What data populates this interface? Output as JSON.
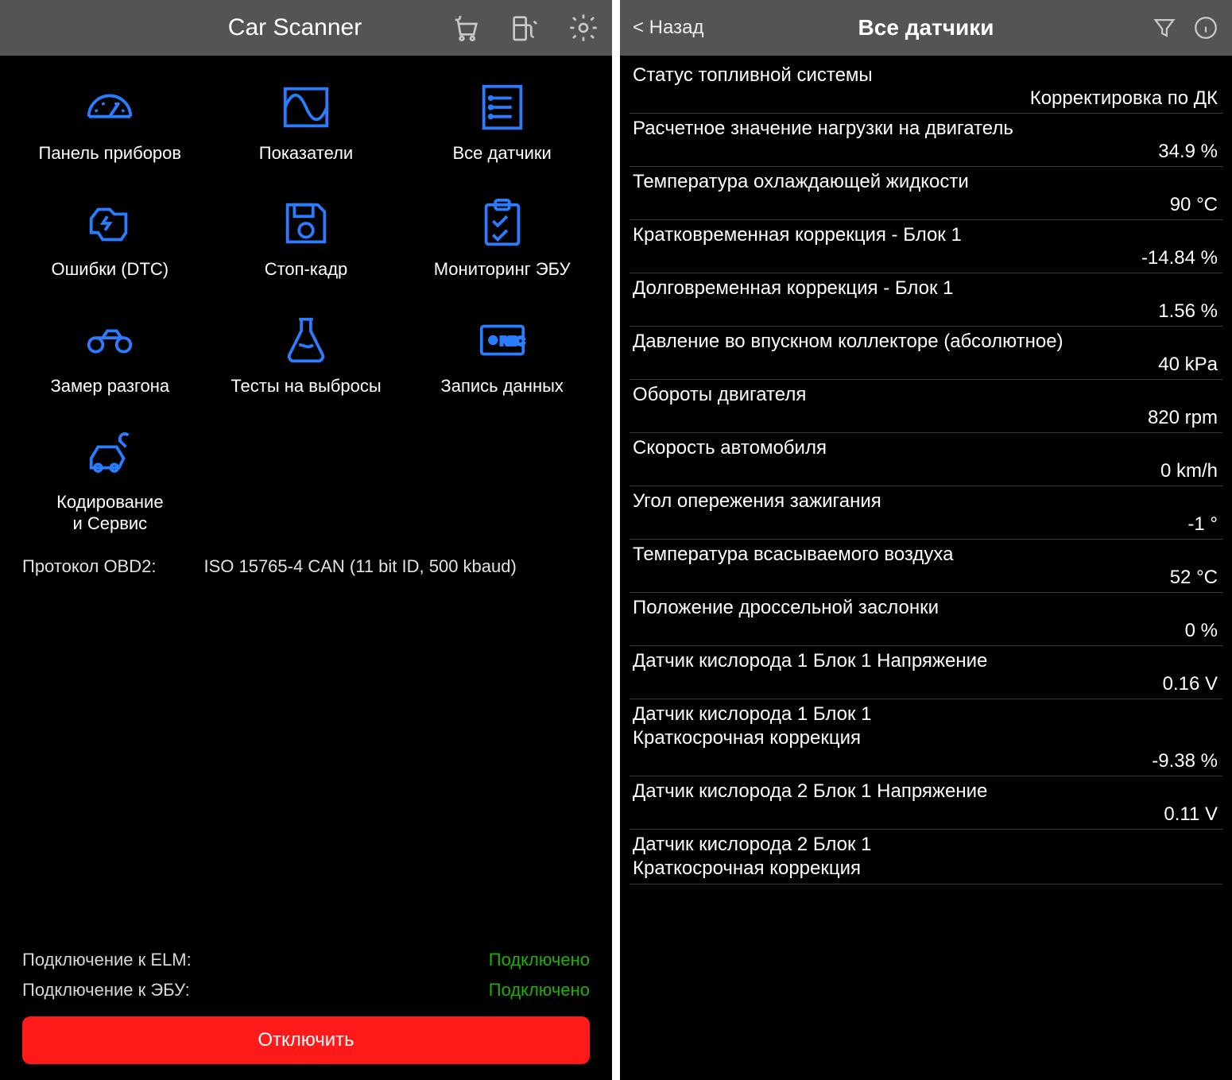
{
  "left": {
    "title": "Car Scanner",
    "tiles": [
      {
        "label": "Панель приборов"
      },
      {
        "label": "Показатели"
      },
      {
        "label": "Все датчики"
      },
      {
        "label": "Ошибки (DTC)"
      },
      {
        "label": "Стоп-кадр"
      },
      {
        "label": "Мониторинг ЭБУ"
      },
      {
        "label": "Замер разгона"
      },
      {
        "label": "Тесты на выбросы"
      },
      {
        "label": "Запись данных"
      },
      {
        "label": "Кодирование\nи Сервис"
      }
    ],
    "protocol_label": "Протокол OBD2:",
    "protocol_value": "ISO 15765-4 CAN (11 bit ID, 500 kbaud)",
    "status": [
      {
        "label": "Подключение к ELM:",
        "value": "Подключено"
      },
      {
        "label": "Подключение к ЭБУ:",
        "value": "Подключено"
      }
    ],
    "disconnect_label": "Отключить"
  },
  "right": {
    "back_label": "< Назад",
    "title": "Все датчики",
    "sensors": [
      {
        "label": "Статус топливной системы",
        "value": "Корректировка по ДК"
      },
      {
        "label": "Расчетное значение нагрузки на двигатель",
        "value": "34.9 %"
      },
      {
        "label": "Температура охлаждающей жидкости",
        "value": "90 °C"
      },
      {
        "label": "Кратковременная коррекция - Блок 1",
        "value": "-14.84 %"
      },
      {
        "label": "Долговременная коррекция - Блок 1",
        "value": "1.56 %"
      },
      {
        "label": "Давление во впускном коллекторе (абсолютное)",
        "value": "40 kPa"
      },
      {
        "label": "Обороты двигателя",
        "value": "820 rpm"
      },
      {
        "label": "Скорость автомобиля",
        "value": "0 km/h"
      },
      {
        "label": "Угол опережения зажигания",
        "value": "-1 °"
      },
      {
        "label": "Температура всасываемого воздуха",
        "value": "52 °C"
      },
      {
        "label": "Положение дроссельной заслонки",
        "value": "0 %"
      },
      {
        "label": "Датчик кислорода 1 Блок 1 Напряжение",
        "value": "0.16 V"
      },
      {
        "label": "Датчик кислорода 1 Блок 1\nКраткосрочная коррекция",
        "value": "-9.38 %"
      },
      {
        "label": "Датчик кислорода 2 Блок 1 Напряжение",
        "value": "0.11 V"
      },
      {
        "label": "Датчик кислорода 2 Блок 1\nКраткосрочная коррекция",
        "value": ""
      }
    ]
  }
}
